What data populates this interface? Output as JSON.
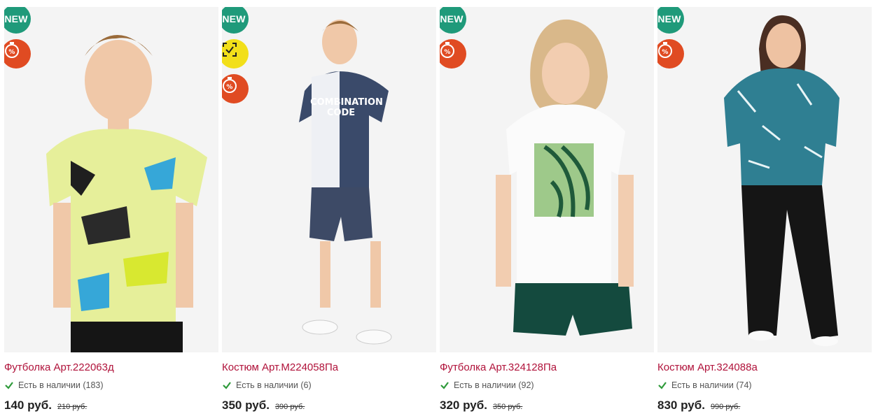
{
  "badges": {
    "new_label": "NEW",
    "mark_label": "ЧЕСТНЫЙ ЗНАК",
    "new_color": "#1f9a7a",
    "sale_color": "#e04b22",
    "mark_color": "#f2df1a"
  },
  "products": [
    {
      "title": "Футболка Арт.222063д",
      "stock": "Есть в наличии (183)",
      "price": "140 руб.",
      "old_price": "210 руб.",
      "badges": [
        "new",
        "sale"
      ]
    },
    {
      "title": "Костюм Арт.М224058Па",
      "stock": "Есть в наличии (6)",
      "price": "350 руб.",
      "old_price": "390 руб.",
      "badges": [
        "new",
        "honest-mark",
        "sale"
      ]
    },
    {
      "title": "Футболка Арт.324128Па",
      "stock": "Есть в наличии (92)",
      "price": "320 руб.",
      "old_price": "350 руб.",
      "badges": [
        "new",
        "sale"
      ]
    },
    {
      "title": "Костюм Арт.324088а",
      "stock": "Есть в наличии (74)",
      "price": "830 руб.",
      "old_price": "990 руб.",
      "badges": [
        "new",
        "sale"
      ]
    }
  ],
  "colors": {
    "title": "#b0123a",
    "stock_check": "#2e9a3a"
  },
  "icons": {
    "sale_icon": "stopwatch-percent-icon",
    "stock_icon": "check-icon",
    "mark_icon": "scan-frame-icon"
  }
}
